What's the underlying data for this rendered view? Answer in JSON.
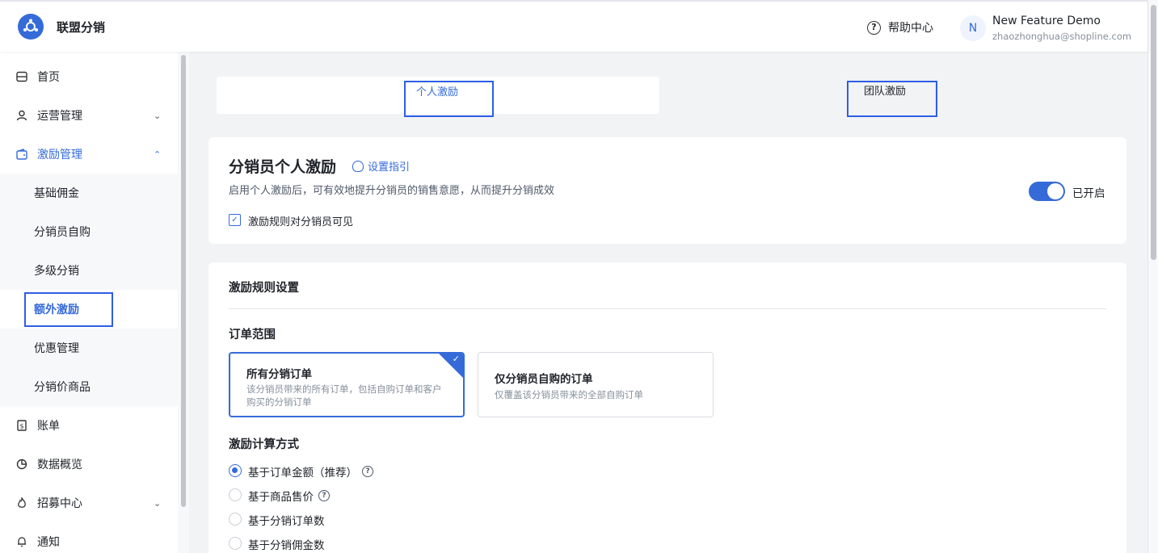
{
  "app": {
    "title": "联盟分销",
    "brand_color": "#356bd8"
  },
  "header": {
    "help_label": "帮助中心",
    "avatar_initial": "N",
    "user_name": "New Feature Demo",
    "user_email": "zhaozhonghua@shopline.com"
  },
  "sidebar": {
    "items": [
      {
        "label": "首页",
        "icon": "home-icon"
      },
      {
        "label": "运营管理",
        "icon": "user-icon"
      },
      {
        "label": "激励管理",
        "icon": "wallet-icon"
      },
      {
        "label": "账单",
        "icon": "bill-icon"
      },
      {
        "label": "数据概览",
        "icon": "pie-chart-icon"
      },
      {
        "label": "招募中心",
        "icon": "fire-icon"
      },
      {
        "label": "通知",
        "icon": "bell-icon"
      }
    ],
    "sub_items": [
      "基础佣金",
      "分销员自购",
      "多级分销",
      "额外激励",
      "优惠管理",
      "分销价商品"
    ]
  },
  "tabs": {
    "personal": "个人激励",
    "team": "团队激励"
  },
  "incentive_card": {
    "title": "分销员个人激励",
    "guide_link": "设置指引",
    "description": "启用个人激励后，可有效地提升分销员的销售意愿，从而提升分销成效",
    "visible_checkbox_label": "激励规则对分销员可见",
    "visible_checked": true,
    "toggle_on": true,
    "toggle_label": "已开启"
  },
  "rules": {
    "section_title": "激励规则设置",
    "order_scope_label": "订单范围",
    "order_scope_options": [
      {
        "title": "所有分销订单",
        "desc": "该分销员带来的所有订单，包括自购订单和客户购买的分销订单",
        "selected": true
      },
      {
        "title": "仅分销员自购的订单",
        "desc": "仅覆盖该分销员带来的全部自购订单",
        "selected": false
      }
    ],
    "calc_method_label": "激励计算方式",
    "calc_methods": [
      {
        "label": "基于订单金额（推荐）",
        "selected": true,
        "has_help": true
      },
      {
        "label": "基于商品售价",
        "selected": false,
        "has_help": true
      },
      {
        "label": "基于分销订单数",
        "selected": false,
        "has_help": false
      },
      {
        "label": "基于分销佣金数",
        "selected": false,
        "has_help": false
      }
    ]
  }
}
